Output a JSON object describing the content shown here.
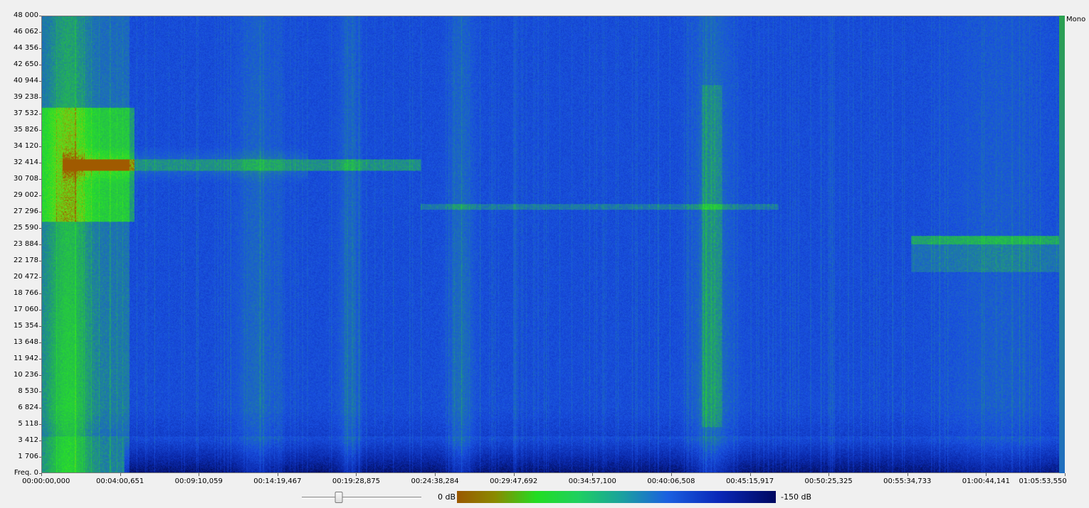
{
  "app": {
    "channel_label": "Mono"
  },
  "spectrogram": {
    "freq_axis_labels": [
      "48 000",
      "46 062",
      "44 356",
      "42 650",
      "40 944",
      "39 238",
      "37 532",
      "35 826",
      "34 120",
      "32 414",
      "30 708",
      "29 002",
      "27 296",
      "25 590",
      "23 884",
      "22 178",
      "20 472",
      "18 766",
      "17 060",
      "15 354",
      "13 648",
      "11 942",
      "10 236",
      "8 530",
      "6 824",
      "5 118",
      "3 412",
      "1 706",
      "Freq. 0"
    ],
    "time_axis_labels": [
      "00:00:00,000",
      "00:04:00,651",
      "00:09:10,059",
      "00:14:19,467",
      "00:19:28,875",
      "00:24:38,284",
      "00:29:47,692",
      "00:34:57,100",
      "00:40:06,508",
      "00:45:15,917",
      "00:50:25,325",
      "00:55:34,733",
      "01:00:44,141",
      "01:05:53,550"
    ],
    "colors": {
      "background": "#1840c8",
      "hot": "#22dd22",
      "peak": "#9a5800",
      "floor": "#000860"
    }
  },
  "controls": {
    "zoom_slider": {
      "value": 0.31
    },
    "scale_max_label": "0 dB",
    "scale_min_label": "-150 dB"
  }
}
